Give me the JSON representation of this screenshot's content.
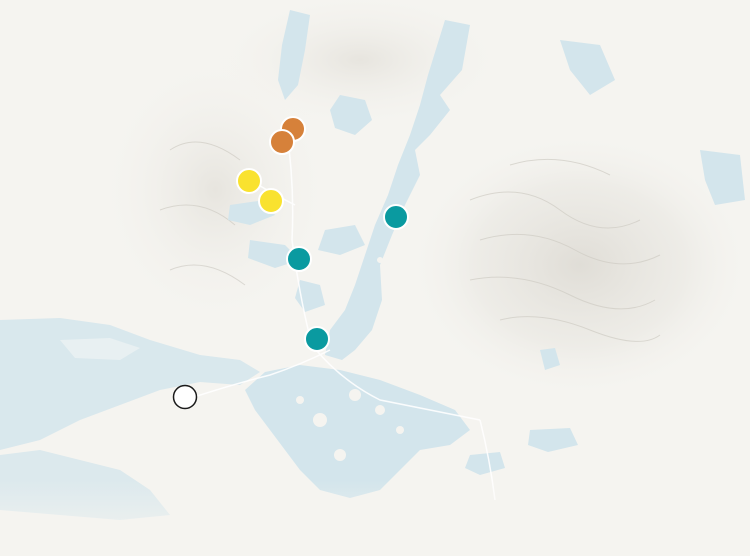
{
  "map": {
    "colors": {
      "land": "#f5f4f0",
      "water": "#d3e5ec",
      "relief": "#e2e0da",
      "roads": "#ffffff"
    },
    "marker_groups": [
      {
        "group": "orange",
        "fill": "#d6813a",
        "count": 2
      },
      {
        "group": "yellow",
        "fill": "#f9e22f",
        "count": 2
      },
      {
        "group": "teal",
        "fill": "#0a9aa0",
        "count": 3
      },
      {
        "group": "white",
        "fill": "#ffffff",
        "count": 1
      }
    ]
  }
}
